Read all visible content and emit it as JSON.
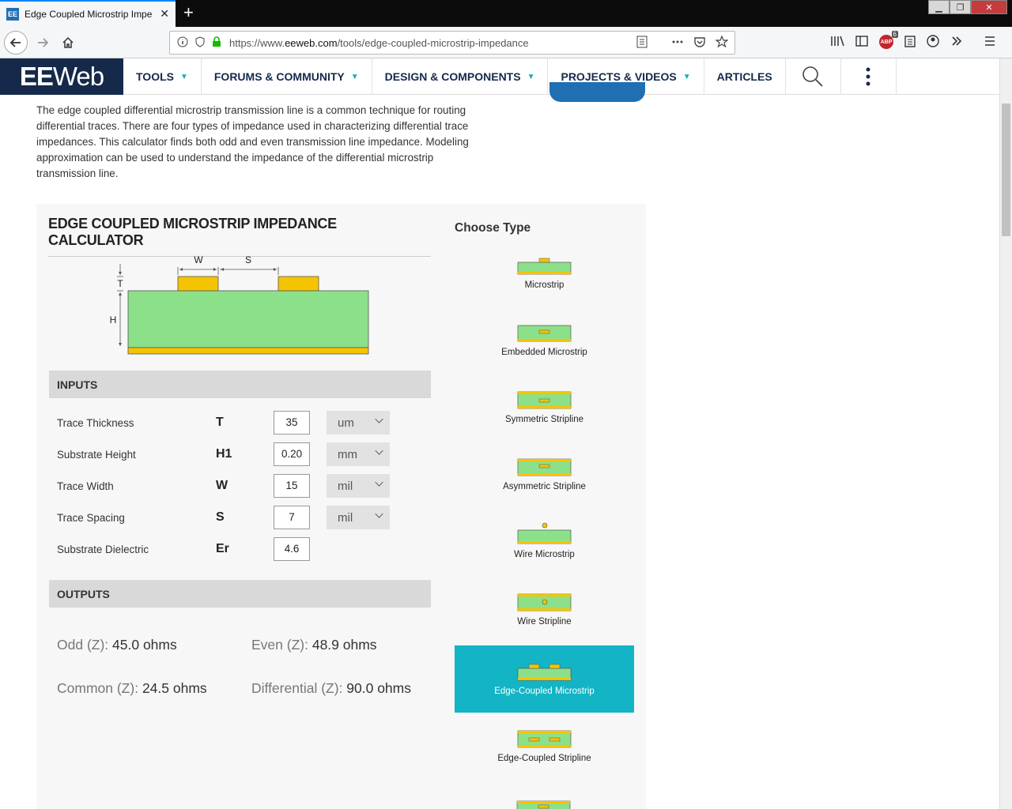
{
  "browser": {
    "tab_title": "Edge Coupled Microstrip Impe",
    "favicon_text": "EE",
    "close_glyph": "✕",
    "newtab_glyph": "+",
    "win_minimize": "▁",
    "win_restore": "❐",
    "win_close": "✕",
    "url_prefix": "https://www.",
    "url_domain": "eeweb.com",
    "url_path": "/tools/edge-coupled-microstrip-impedance",
    "addon_badge_text": "ABP",
    "addon_badge_count": "6"
  },
  "site": {
    "logo_bold": "EE",
    "logo_rest": "Web",
    "menu": [
      {
        "label": "TOOLS"
      },
      {
        "label": "FORUMS & COMMUNITY"
      },
      {
        "label": "DESIGN & COMPONENTS"
      },
      {
        "label": "PROJECTS & VIDEOS"
      },
      {
        "label": "ARTICLES"
      }
    ]
  },
  "intro_text": "The edge coupled differential microstrip transmission line is a common technique for routing differential traces. There are four types of impedance used in characterizing differential trace impedances. This calculator finds both odd and even transmission line impedance. Modeling approximation can be used to understand the impedance of the differential microstrip transmission line.",
  "calculator": {
    "title": "EDGE COUPLED MICROSTRIP IMPEDANCE CALCULATOR",
    "diagram_labels": {
      "w": "W",
      "s": "S",
      "t": "T",
      "h": "H"
    },
    "inputs_header": "INPUTS",
    "inputs": [
      {
        "label": "Trace Thickness",
        "symbol": "T",
        "value": "35",
        "unit": "um"
      },
      {
        "label": "Substrate Height",
        "symbol": "H1",
        "value": "0.20",
        "unit": "mm"
      },
      {
        "label": "Trace Width",
        "symbol": "W",
        "value": "15",
        "unit": "mil"
      },
      {
        "label": "Trace Spacing",
        "symbol": "S",
        "value": "7",
        "unit": "mil"
      },
      {
        "label": "Substrate Dielectric",
        "symbol": "Er",
        "value": "4.6",
        "unit": ""
      }
    ],
    "outputs_header": "OUTPUTS",
    "outputs": {
      "odd_label": "Odd (Z):",
      "odd_value": "45.0 ohms",
      "even_label": "Even (Z):",
      "even_value": "48.9 ohms",
      "common_label": "Common (Z):",
      "common_value": "24.5 ohms",
      "diff_label": "Differential (Z):",
      "diff_value": "90.0 ohms"
    }
  },
  "types": {
    "heading": "Choose Type",
    "items": [
      {
        "label": "Microstrip"
      },
      {
        "label": "Embedded Microstrip"
      },
      {
        "label": "Symmetric Stripline"
      },
      {
        "label": "Asymmetric Stripline"
      },
      {
        "label": "Wire Microstrip"
      },
      {
        "label": "Wire Stripline"
      },
      {
        "label": "Edge-Coupled Microstrip"
      },
      {
        "label": "Edge-Coupled Stripline"
      }
    ],
    "selected": "Edge-Coupled Microstrip"
  },
  "colors": {
    "substrate": "#8de08a",
    "copper": "#f5c400",
    "selected_type_bg": "#12b4c5",
    "header_navy": "#15294b",
    "accent_teal": "#1ba8c4"
  }
}
